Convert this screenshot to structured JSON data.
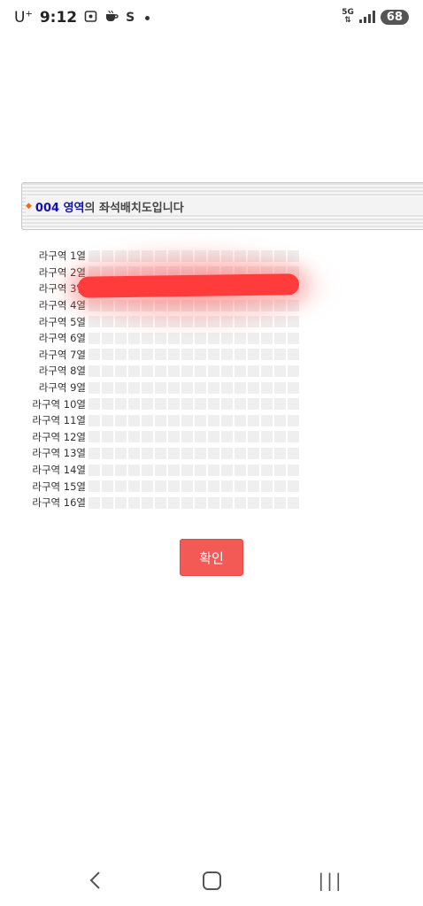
{
  "status_bar": {
    "carrier": "U",
    "carrier_sup": "+",
    "time": "9:12",
    "network": "5G",
    "battery": "68",
    "icons": [
      "screenshot-icon",
      "coffee-icon",
      "s-icon",
      "dot-icon",
      "network-5g-icon",
      "signal-icon",
      "battery-icon"
    ]
  },
  "header": {
    "zone": "004 영역",
    "suffix": "의 좌석배치도입니다",
    "bullet_color": "#f06a14",
    "zone_color": "#1212b8"
  },
  "seat_map": {
    "seats_per_row": 16,
    "rows": [
      "라구역 1열",
      "라구역 2열",
      "라구역 3열",
      "라구역 4열",
      "라구역 5열",
      "라구역 6열",
      "라구역 7열",
      "라구역 8열",
      "라구역 9열",
      "라구역 10열",
      "라구역 11열",
      "라구역 12열",
      "라구역 13열",
      "라구역 14열",
      "라구역 15열",
      "라구역 16열"
    ],
    "seat_color": "#efefef"
  },
  "confirm_button": {
    "label": "확인",
    "color": "#f45a55"
  },
  "nav_bar": {
    "back": "‹",
    "recent": "|||"
  }
}
